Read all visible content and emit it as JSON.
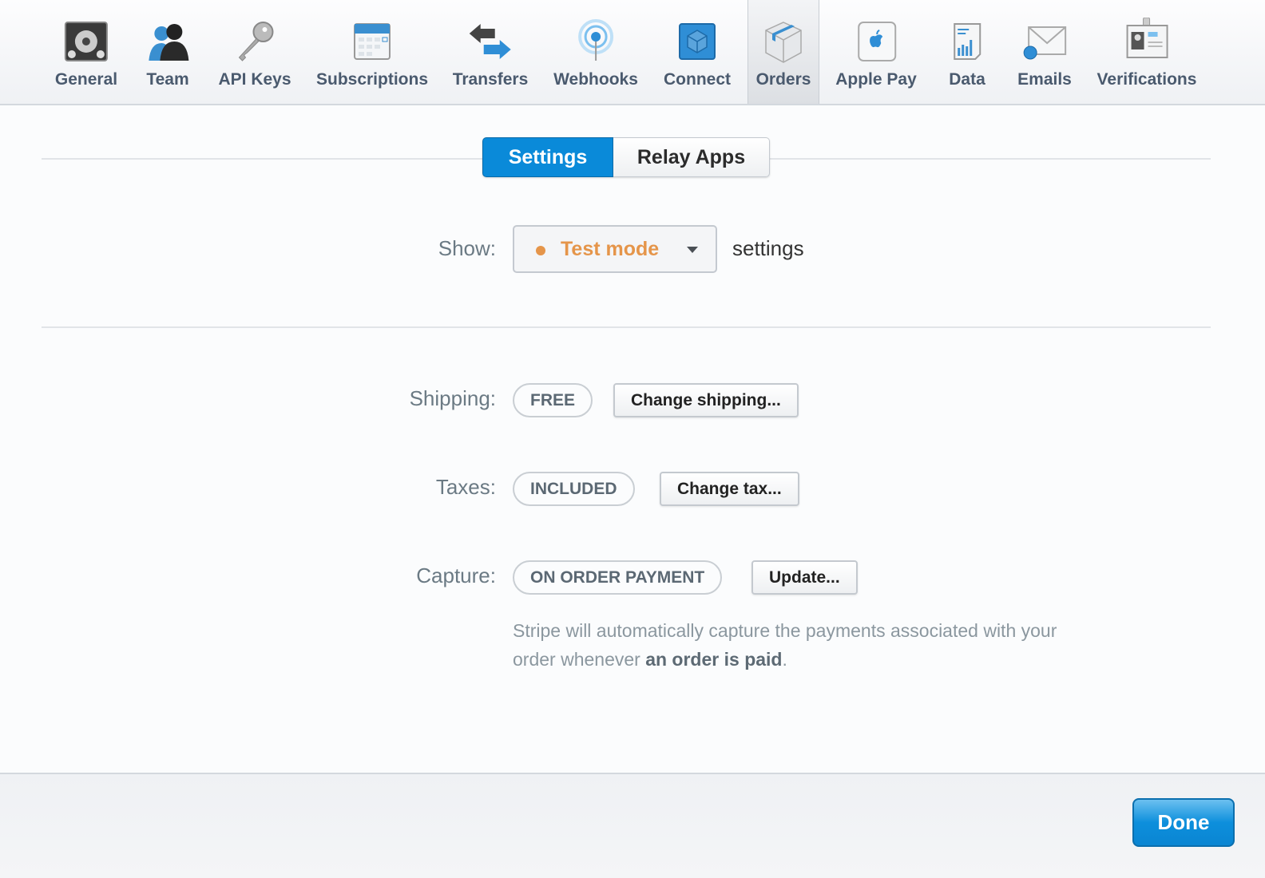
{
  "toolbar": {
    "items": [
      {
        "label": "General",
        "icon": "gear-icon"
      },
      {
        "label": "Team",
        "icon": "team-icon"
      },
      {
        "label": "API Keys",
        "icon": "key-icon"
      },
      {
        "label": "Subscriptions",
        "icon": "calendar-icon"
      },
      {
        "label": "Transfers",
        "icon": "transfer-arrows-icon"
      },
      {
        "label": "Webhooks",
        "icon": "broadcast-icon"
      },
      {
        "label": "Connect",
        "icon": "cube-icon"
      },
      {
        "label": "Orders",
        "icon": "box-icon"
      },
      {
        "label": "Apple Pay",
        "icon": "apple-icon"
      },
      {
        "label": "Data",
        "icon": "chart-document-icon"
      },
      {
        "label": "Emails",
        "icon": "envelope-icon"
      },
      {
        "label": "Verifications",
        "icon": "id-badge-icon"
      }
    ],
    "selected": "Orders"
  },
  "tabs": {
    "settings": "Settings",
    "relay_apps": "Relay Apps"
  },
  "show": {
    "label": "Show:",
    "value": "Test mode",
    "suffix": "settings",
    "color": "#e5954a"
  },
  "rows": {
    "shipping": {
      "label": "Shipping:",
      "value": "FREE",
      "button": "Change shipping..."
    },
    "taxes": {
      "label": "Taxes:",
      "value": "INCLUDED",
      "button": "Change tax..."
    },
    "capture": {
      "label": "Capture:",
      "value": "ON ORDER PAYMENT",
      "button": "Update..."
    }
  },
  "description": {
    "text": "Stripe will automatically capture the payments associated with your order whenever ",
    "bold": "an order is paid",
    "end": "."
  },
  "footer": {
    "done": "Done"
  },
  "colors": {
    "accent": "#0a8ad9"
  }
}
